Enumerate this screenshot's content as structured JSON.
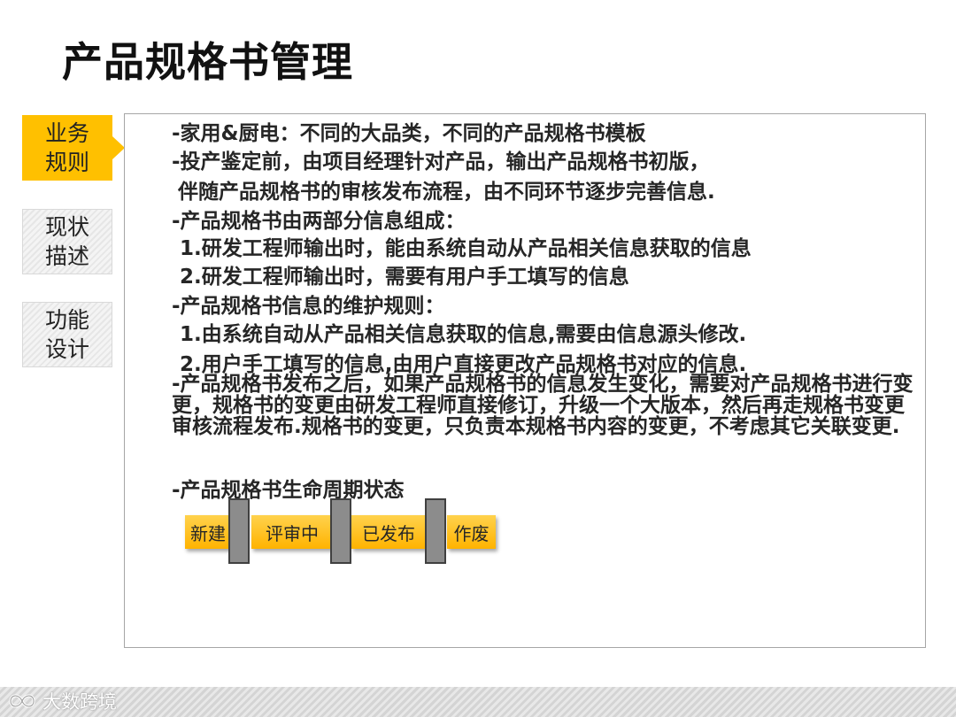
{
  "title": "产品规格书管理",
  "sidebar": {
    "tabs": [
      {
        "label": "业务\n规则",
        "active": true
      },
      {
        "label": "现状\n描述",
        "active": false
      },
      {
        "label": "功能\n设计",
        "active": false
      }
    ]
  },
  "content": {
    "lines": [
      "-家用&厨电：不同的大品类，不同的产品规格书模板",
      "-投产鉴定前，由项目经理针对产品，输出产品规格书初版，",
      "伴随产品规格书的审核发布流程，由不同环节逐步完善信息.",
      "-产品规格书由两部分信息组成：",
      "1.研发工程师输出时，能由系统自动从产品相关信息获取的信息",
      "2.研发工程师输出时，需要有用户手工填写的信息",
      "-产品规格书信息的维护规则：",
      "1.由系统自动从产品相关信息获取的信息,需要由信息源头修改.",
      "2.用户手工填写的信息,由用户直接更改产品规格书对应的信息."
    ],
    "change_paragraph": "-产品规格书发布之后，如果产品规格书的信息发生变化，需要对产品规格书进行变更，规格书的变更由研发工程师直接修订，升级一个大版本，然后再走规格书变更审核流程发布.规格书的变更，只负责本规格书内容的变更，不考虑其它关联变更.",
    "lifecycle_heading": "-产品规格书生命周期状态"
  },
  "lifecycle": {
    "stages": [
      "新建",
      "评审中",
      "已发布",
      "作废"
    ]
  },
  "footer": {
    "watermark_icon": "infinity-logo-icon",
    "watermark_text": "大数跨境"
  },
  "colors": {
    "accent": "#ffc000",
    "text": "#262626",
    "separator": "#8c8c8c"
  }
}
